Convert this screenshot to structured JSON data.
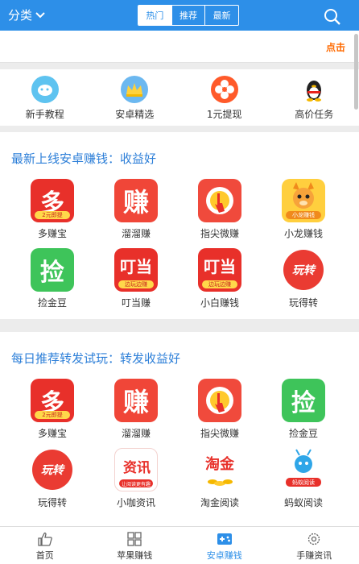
{
  "header": {
    "category_label": "分类",
    "tabs": [
      {
        "label": "热门",
        "active": true
      },
      {
        "label": "推荐",
        "active": false
      },
      {
        "label": "最新",
        "active": false
      }
    ],
    "accent_color": "#2d8fe8"
  },
  "marquee": {
    "text": "点击"
  },
  "quick_nav": [
    {
      "label": "新手教程",
      "icon": "tutorial-icon"
    },
    {
      "label": "安卓精选",
      "icon": "crown-icon"
    },
    {
      "label": "1元提现",
      "icon": "fan-icon"
    },
    {
      "label": "高价任务",
      "icon": "penguin-icon"
    }
  ],
  "section1": {
    "title": "最新上线安卓赚钱：收益好",
    "apps": [
      {
        "name": "多赚宝",
        "glyph": "多",
        "badge": "2元即提"
      },
      {
        "name": "溜溜赚",
        "glyph": "赚",
        "badge": ""
      },
      {
        "name": "指尖微赚",
        "glyph": "",
        "badge": ""
      },
      {
        "name": "小龙赚钱",
        "glyph": "",
        "badge": "小龙赚钱"
      },
      {
        "name": "捡金豆",
        "glyph": "捡",
        "badge": ""
      },
      {
        "name": "叮当赚",
        "glyph": "叮当",
        "badge": "边玩边赚"
      },
      {
        "name": "小白赚钱",
        "glyph": "叮当",
        "badge": "边玩边赚"
      },
      {
        "name": "玩得转",
        "glyph": "玩转",
        "badge": ""
      }
    ]
  },
  "section2": {
    "title": "每日推荐转发试玩：转发收益好",
    "apps": [
      {
        "name": "多赚宝",
        "glyph": "多",
        "badge": "2元即提"
      },
      {
        "name": "溜溜赚",
        "glyph": "赚",
        "badge": ""
      },
      {
        "name": "指尖微赚",
        "glyph": "",
        "badge": ""
      },
      {
        "name": "捡金豆",
        "glyph": "捡",
        "badge": ""
      },
      {
        "name": "玩得转",
        "glyph": "玩转",
        "badge": ""
      },
      {
        "name": "小咖资讯",
        "glyph": "资讯",
        "badge": "让阅读更有趣"
      },
      {
        "name": "淘金阅读",
        "glyph": "淘金",
        "badge": ""
      },
      {
        "name": "蚂蚁阅读",
        "glyph": "",
        "badge": "蚂蚁阅读"
      }
    ]
  },
  "bottom_nav": [
    {
      "label": "首页",
      "icon": "thumbs-up-icon",
      "active": false
    },
    {
      "label": "苹果赚钱",
      "icon": "grid-icon",
      "active": false
    },
    {
      "label": "安卓赚钱",
      "icon": "gamepad-icon",
      "active": true
    },
    {
      "label": "手赚资讯",
      "icon": "gear-icon",
      "active": false
    }
  ]
}
